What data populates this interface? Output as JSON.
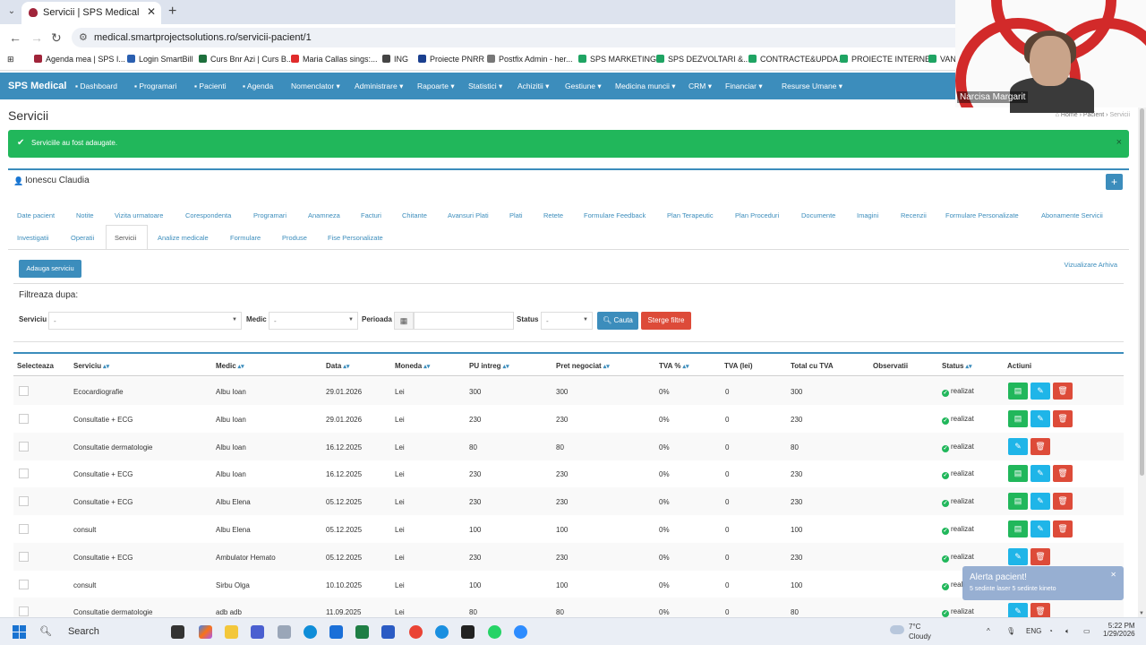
{
  "browser": {
    "tab_title": "Servicii | SPS Medical",
    "url": "medical.smartprojectsolutions.ro/servicii-pacient/1",
    "bookmarks": [
      {
        "label": "Agenda mea | SPS I...",
        "color": "#a0243a"
      },
      {
        "label": "Login SmartBill",
        "color": "#2a5fb0"
      },
      {
        "label": "Curs Bnr Azi | Curs B...",
        "color": "#1d6f3c"
      },
      {
        "label": "Maria Callas sings:...",
        "color": "#e02b2b"
      },
      {
        "label": "ING",
        "color": "#444444"
      },
      {
        "label": "Proiecte PNRR",
        "color": "#1a3f8f"
      },
      {
        "label": "Postfix Admin - her...",
        "color": "#777777"
      },
      {
        "label": "SPS MARKETING",
        "color": "#1fa463"
      },
      {
        "label": "SPS DEZVOLTARI &...",
        "color": "#1fa463"
      },
      {
        "label": "CONTRACTE&UPDA...",
        "color": "#1fa463"
      },
      {
        "label": "PROIECTE INTERNE",
        "color": "#1fa463"
      },
      {
        "label": "VAN",
        "color": "#1fa463"
      }
    ]
  },
  "appnav": {
    "brand": "SPS Medical",
    "items": [
      {
        "label": "Dashboard",
        "icon": "dashboard-icon"
      },
      {
        "label": "Programari",
        "icon": "calendar-icon"
      },
      {
        "label": "Pacienti",
        "icon": "user-icon"
      },
      {
        "label": "Agenda",
        "icon": "calendar-icon"
      },
      {
        "label": "Nomenclator ▾"
      },
      {
        "label": "Administrare ▾"
      },
      {
        "label": "Rapoarte ▾"
      },
      {
        "label": "Statistici ▾"
      },
      {
        "label": "Achizitii ▾"
      },
      {
        "label": "Gestiune ▾"
      },
      {
        "label": "Medicina muncii ▾"
      },
      {
        "label": "CRM ▾"
      },
      {
        "label": "Financiar ▾"
      },
      {
        "label": "Resurse Umane ▾"
      }
    ]
  },
  "page": {
    "title": "Servicii",
    "breadcrumb": [
      "Home",
      "Pacient",
      "Servicii"
    ],
    "alert": "Serviciile au fost adaugate.",
    "patient_name": "Ionescu Claudia",
    "tabs_row1": [
      "Date pacient",
      "Notite",
      "Vizita urmatoare",
      "Corespondenta",
      "Programari",
      "Anamneza",
      "Facturi",
      "Chitante",
      "Avansuri Plati",
      "Plati",
      "Retete",
      "Formulare Feedback",
      "Plan Terapeutic",
      "Plan Proceduri",
      "Documente",
      "Imagini",
      "Recenzii",
      "Formulare Personalizate",
      "Abonamente Servicii"
    ],
    "tabs_row2": [
      "Investigatii",
      "Operatii",
      "Servicii",
      "Analize medicale",
      "Formulare",
      "Produse",
      "Fise Personalizate"
    ],
    "active_tab": "Servicii",
    "add_button": "Adauga serviciu",
    "archive_link": "Vizualizare Arhiva"
  },
  "filters": {
    "title": "Filtreaza dupa:",
    "serviciu_label": "Serviciu",
    "serviciu_value": "-",
    "medic_label": "Medic",
    "medic_value": "-",
    "perioada_label": "Perioada",
    "status_label": "Status",
    "status_value": "-",
    "search_button": "Cauta",
    "clear_button": "Sterge filtre"
  },
  "table": {
    "headers": [
      "Selecteaza",
      "Serviciu",
      "Medic",
      "Data",
      "Moneda",
      "PU intreg",
      "Pret negociat",
      "TVA %",
      "TVA (lei)",
      "Total cu TVA",
      "Observatii",
      "Status",
      "Actiuni"
    ],
    "rows": [
      {
        "serviciu": "Ecocardiografie",
        "medic": "Albu Ioan",
        "data": "29.01.2026",
        "moneda": "Lei",
        "pu": "300",
        "pret": "300",
        "tva_pct": "0%",
        "tva_lei": "0",
        "total": "300",
        "obs": "",
        "status": "realizat",
        "actions": [
          "g",
          "b",
          "r"
        ]
      },
      {
        "serviciu": "Consultatie + ECG",
        "medic": "Albu Ioan",
        "data": "29.01.2026",
        "moneda": "Lei",
        "pu": "230",
        "pret": "230",
        "tva_pct": "0%",
        "tva_lei": "0",
        "total": "230",
        "obs": "",
        "status": "realizat",
        "actions": [
          "g",
          "b",
          "r"
        ]
      },
      {
        "serviciu": "Consultatie dermatologie",
        "medic": "Albu Ioan",
        "data": "16.12.2025",
        "moneda": "Lei",
        "pu": "80",
        "pret": "80",
        "tva_pct": "0%",
        "tva_lei": "0",
        "total": "80",
        "obs": "",
        "status": "realizat",
        "actions": [
          "b",
          "r"
        ]
      },
      {
        "serviciu": "Consultatie + ECG",
        "medic": "Albu Ioan",
        "data": "16.12.2025",
        "moneda": "Lei",
        "pu": "230",
        "pret": "230",
        "tva_pct": "0%",
        "tva_lei": "0",
        "total": "230",
        "obs": "",
        "status": "realizat",
        "actions": [
          "g",
          "b",
          "r"
        ]
      },
      {
        "serviciu": "Consultatie + ECG",
        "medic": "Albu Elena",
        "data": "05.12.2025",
        "moneda": "Lei",
        "pu": "230",
        "pret": "230",
        "tva_pct": "0%",
        "tva_lei": "0",
        "total": "230",
        "obs": "",
        "status": "realizat",
        "actions": [
          "g",
          "b",
          "r"
        ]
      },
      {
        "serviciu": "consult",
        "medic": "Albu Elena",
        "data": "05.12.2025",
        "moneda": "Lei",
        "pu": "100",
        "pret": "100",
        "tva_pct": "0%",
        "tva_lei": "0",
        "total": "100",
        "obs": "",
        "status": "realizat",
        "actions": [
          "g",
          "b",
          "r"
        ]
      },
      {
        "serviciu": "Consultatie + ECG",
        "medic": "Ambulator Hemato",
        "data": "05.12.2025",
        "moneda": "Lei",
        "pu": "230",
        "pret": "230",
        "tva_pct": "0%",
        "tva_lei": "0",
        "total": "230",
        "obs": "",
        "status": "realizat",
        "actions": [
          "b",
          "r"
        ]
      },
      {
        "serviciu": "consult",
        "medic": "Sirbu Olga",
        "data": "10.10.2025",
        "moneda": "Lei",
        "pu": "100",
        "pret": "100",
        "tva_pct": "0%",
        "tva_lei": "0",
        "total": "100",
        "obs": "",
        "status": "reali",
        "actions": []
      },
      {
        "serviciu": "Consultatie dermatologie",
        "medic": "adb adb",
        "data": "11.09.2025",
        "moneda": "Lei",
        "pu": "80",
        "pret": "80",
        "tva_pct": "0%",
        "tva_lei": "0",
        "total": "80",
        "obs": "",
        "status": "realizat",
        "actions": [
          "b",
          "r"
        ]
      }
    ]
  },
  "toast": {
    "title": "Alerta pacient!",
    "message": "5 sedinte laser 5 sedinte kineto"
  },
  "webcam": {
    "name": "Narcisa Margarit"
  },
  "taskbar": {
    "search": "Search",
    "weather_temp": "7°C",
    "weather_desc": "Cloudy",
    "lang": "ENG",
    "time": "5:22 PM",
    "date": "1/29/2026"
  }
}
